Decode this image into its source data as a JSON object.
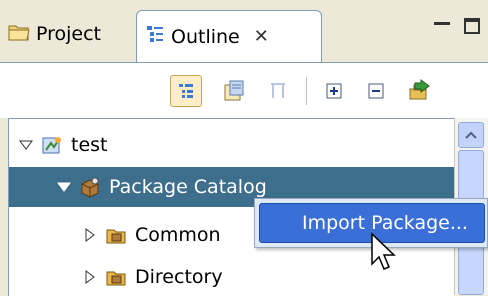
{
  "tabs": [
    {
      "label": "Project",
      "icon": "folder-icon",
      "active": false
    },
    {
      "label": "Outline",
      "icon": "outline-tree-icon",
      "active": true,
      "close": "✕"
    }
  ],
  "toolbar": {
    "buttons": [
      "hierarchy-icon",
      "properties-icon",
      "filter-icon",
      "expand-all-icon",
      "collapse-all-icon",
      "import-icon"
    ]
  },
  "tree": {
    "rows": [
      {
        "label": "test",
        "icon": "model-icon",
        "expanded": true
      },
      {
        "label": "Package Catalog",
        "icon": "package-catalog-icon",
        "expanded": true,
        "selected": true
      },
      {
        "label": "Common",
        "icon": "package-folder-icon",
        "expanded": false
      },
      {
        "label": "Directory",
        "icon": "package-folder-icon",
        "expanded": false
      }
    ]
  },
  "context_menu": {
    "item": "Import Package..."
  },
  "colors": {
    "selection": "#3d6e8c",
    "menu_highlight": "#3a6fd8",
    "panel_bg": "#ece9d8"
  }
}
